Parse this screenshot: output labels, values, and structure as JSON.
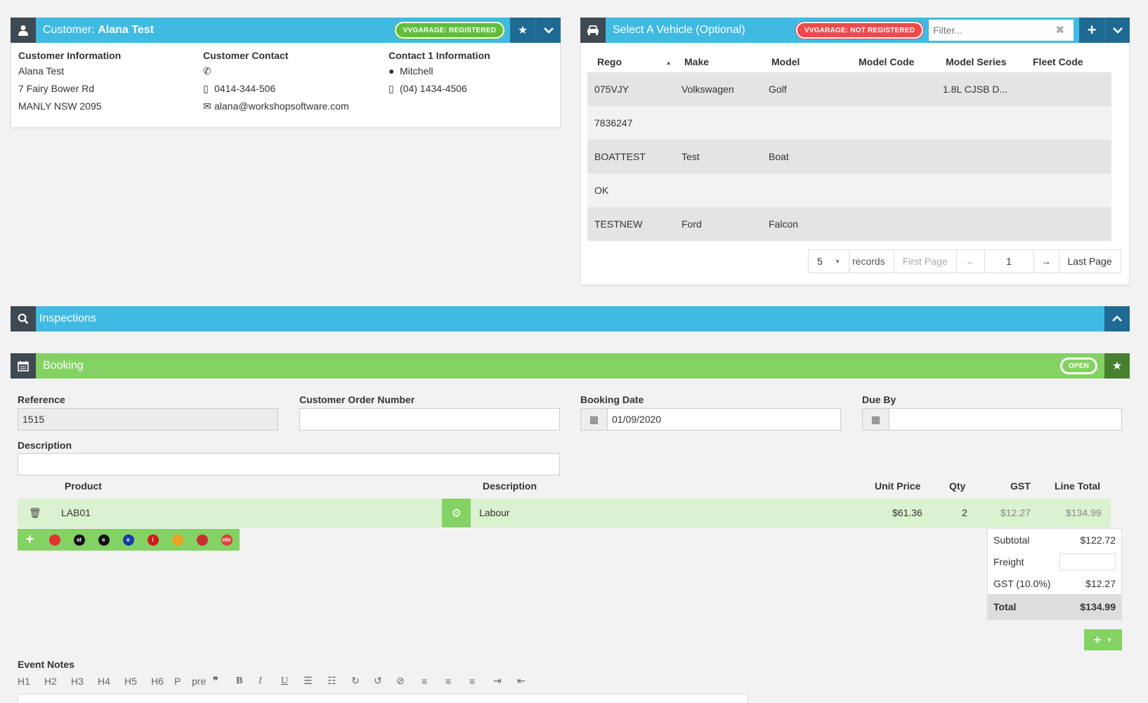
{
  "customer_panel": {
    "title_prefix": "Customer:",
    "title_name": "Alana Test",
    "badge": "VVGARAGE: REGISTERED",
    "info_heading": "Customer Information",
    "info_name": "Alana Test",
    "info_address1": "7 Fairy Bower Rd",
    "info_address2": "MANLY NSW 2095",
    "contact_heading": "Customer Contact",
    "contact_mobile": "0414-344-506",
    "contact_email": "alana@workshopsoftware.com",
    "contact1_heading": "Contact 1 Information",
    "contact1_name": "Mitchell",
    "contact1_phone": "(04) 1434-4506"
  },
  "vehicle_panel": {
    "title": "Select A Vehicle (Optional)",
    "badge": "VVGARAGE: NOT REGISTERED",
    "filter_placeholder": "Filter...",
    "columns": [
      "Rego",
      "Make",
      "Model",
      "Model Code",
      "Model Series",
      "Fleet Code"
    ],
    "rows": [
      {
        "rego": "075VJY",
        "make": "Volkswagen",
        "model": "Golf",
        "model_code": "",
        "model_series": "1.8L CJSB D...",
        "fleet_code": ""
      },
      {
        "rego": "7836247",
        "make": "",
        "model": "",
        "model_code": "",
        "model_series": "",
        "fleet_code": ""
      },
      {
        "rego": "BOATTEST",
        "make": "Test",
        "model": "Boat",
        "model_code": "",
        "model_series": "",
        "fleet_code": ""
      },
      {
        "rego": "OK",
        "make": "",
        "model": "",
        "model_code": "",
        "model_series": "",
        "fleet_code": ""
      },
      {
        "rego": "TESTNEW",
        "make": "Ford",
        "model": "Falcon",
        "model_code": "",
        "model_series": "",
        "fleet_code": ""
      }
    ],
    "pager": {
      "page_size": "5",
      "records_label": "records",
      "first_page": "First Page",
      "prev": "←",
      "current": "1",
      "next": "→",
      "last_page": "Last Page"
    }
  },
  "inspections_panel": {
    "title": "Inspections"
  },
  "booking_panel": {
    "title": "Booking",
    "status_badge": "OPEN",
    "reference_label": "Reference",
    "reference_value": "1515",
    "order_number_label": "Customer  Order Number",
    "booking_date_label": "Booking Date",
    "booking_date_value": "01/09/2020",
    "due_by_label": "Due By",
    "description_label": "Description",
    "line_headers": {
      "product": "Product",
      "description": "Description",
      "unit_price": "Unit Price",
      "qty": "Qty",
      "gst": "GST",
      "line_total": "Line Total"
    },
    "line_items": [
      {
        "product": "LAB01",
        "description": "Labour",
        "unit_price": "$61.36",
        "qty": "2",
        "gst": "$12.27",
        "line_total": "$134.99"
      }
    ],
    "totals": {
      "subtotal_label": "Subtotal",
      "subtotal_value": "$122.72",
      "freight_label": "Freight",
      "gst_label": "GST (10.0%)",
      "gst_value": "$12.27",
      "total_label": "Total",
      "total_value": "$134.99"
    },
    "event_notes_label": "Event Notes",
    "editor_tools": [
      "H1",
      "H2",
      "H3",
      "H4",
      "H5",
      "H6",
      "P",
      "pre"
    ],
    "toolbar_logos": [
      "",
      "at",
      "e",
      "e",
      "i",
      "",
      "",
      "ntv"
    ]
  },
  "colors": {
    "header_blue": "#3fbae3",
    "header_dark_blue": "#1f6a93",
    "booking_green": "#84d264",
    "registered_green": "#5fbe3c",
    "not_registered_red": "#ef4a4a"
  }
}
